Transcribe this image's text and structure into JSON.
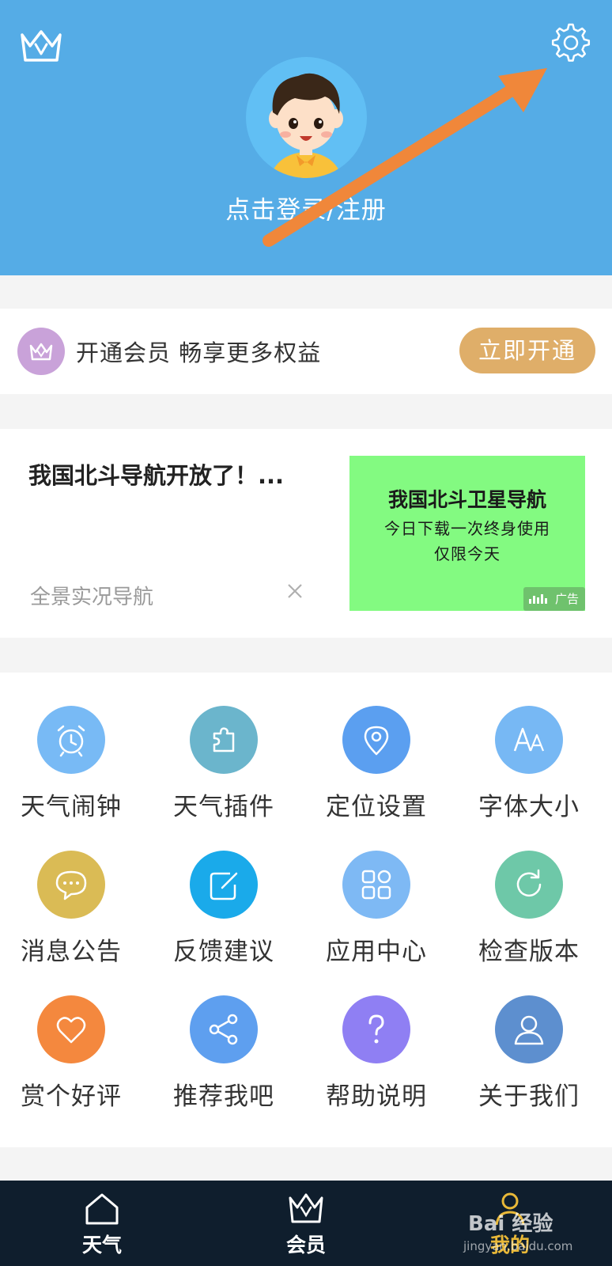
{
  "header": {
    "login_text": "点击登录/注册",
    "bg_color": "#55ace6",
    "annotation": "orange-arrow-pointing-to-settings"
  },
  "member": {
    "text": "开通会员 畅享更多权益",
    "button_label": "立即开通",
    "button_color": "#dfae69"
  },
  "ad": {
    "title": "我国北斗导航开放了！...",
    "source": "全景实况导航",
    "image_title": "我国北斗卫星导航",
    "image_sub": "今日下载一次终身使用",
    "image_sub2": "仅限今天",
    "tag": "广告"
  },
  "grid": {
    "items": [
      {
        "label": "天气闹钟",
        "icon": "alarm-clock-icon",
        "color": "#78baf5"
      },
      {
        "label": "天气插件",
        "icon": "puzzle-icon",
        "color": "#6bb5cc"
      },
      {
        "label": "定位设置",
        "icon": "location-pin-icon",
        "color": "#5b9ff0"
      },
      {
        "label": "字体大小",
        "icon": "font-size-icon",
        "color": "#77b8f4"
      },
      {
        "label": "消息公告",
        "icon": "message-icon",
        "color": "#dabb55"
      },
      {
        "label": "反馈建议",
        "icon": "edit-icon",
        "color": "#1aaaea"
      },
      {
        "label": "应用中心",
        "icon": "app-grid-icon",
        "color": "#7eb9f4"
      },
      {
        "label": "检查版本",
        "icon": "refresh-icon",
        "color": "#6ec8a8"
      },
      {
        "label": "赏个好评",
        "icon": "heart-icon",
        "color": "#f4883e"
      },
      {
        "label": "推荐我吧",
        "icon": "share-icon",
        "color": "#5e9fef"
      },
      {
        "label": "帮助说明",
        "icon": "question-icon",
        "color": "#8f7ff3"
      },
      {
        "label": "关于我们",
        "icon": "user-icon",
        "color": "#5d8fcf"
      }
    ]
  },
  "bottom_nav": {
    "items": [
      {
        "label": "天气",
        "icon": "home-icon"
      },
      {
        "label": "会员",
        "icon": "crown-icon"
      },
      {
        "label": "我的",
        "icon": "profile-icon"
      }
    ]
  },
  "watermark": {
    "text": "Bai 经验",
    "url": "jingyan.baidu.com"
  }
}
